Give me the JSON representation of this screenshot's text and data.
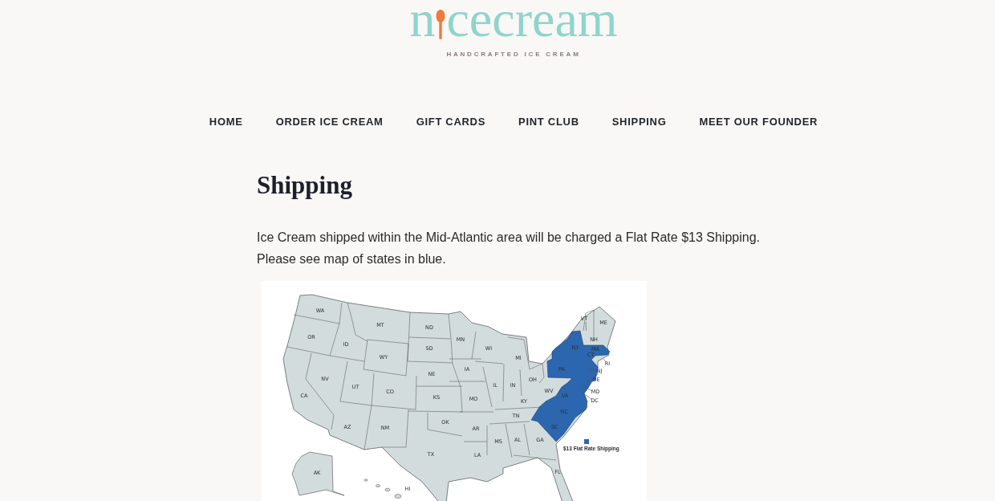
{
  "logo": {
    "wordmark_start": "n",
    "wordmark_end": "cecream",
    "tagline": "HANDCRAFTED ICE CREAM"
  },
  "nav": [
    "HOME",
    "ORDER ICE CREAM",
    "GIFT CARDS",
    "PINT CLUB",
    "SHIPPING",
    "MEET OUR FOUNDER"
  ],
  "page": {
    "heading": "Shipping",
    "paragraphs": [
      "Ice Cream shipped within the Mid-Atlantic area will be charged a Flat Rate $13 Shipping.",
      "Please see map of states in blue."
    ]
  },
  "map": {
    "state_labels": [
      "WA",
      "OR",
      "ID",
      "MT",
      "ND",
      "SD",
      "WY",
      "NE",
      "NV",
      "UT",
      "CO",
      "CA",
      "KS",
      "AZ",
      "NM",
      "OK",
      "TX",
      "AK",
      "HI",
      "MN",
      "WI",
      "MI",
      "IA",
      "IL",
      "IN",
      "OH",
      "MO",
      "KY",
      "WV",
      "VA",
      "TN",
      "NC",
      "AR",
      "MS",
      "AL",
      "GA",
      "SC",
      "LA",
      "FL",
      "NY",
      "PA",
      "ME",
      "VT",
      "NH",
      "MA",
      "CT",
      "RI",
      "NJ",
      "DE",
      "MD",
      "DC"
    ],
    "legend": "$13 Flat Rate Shipping"
  }
}
